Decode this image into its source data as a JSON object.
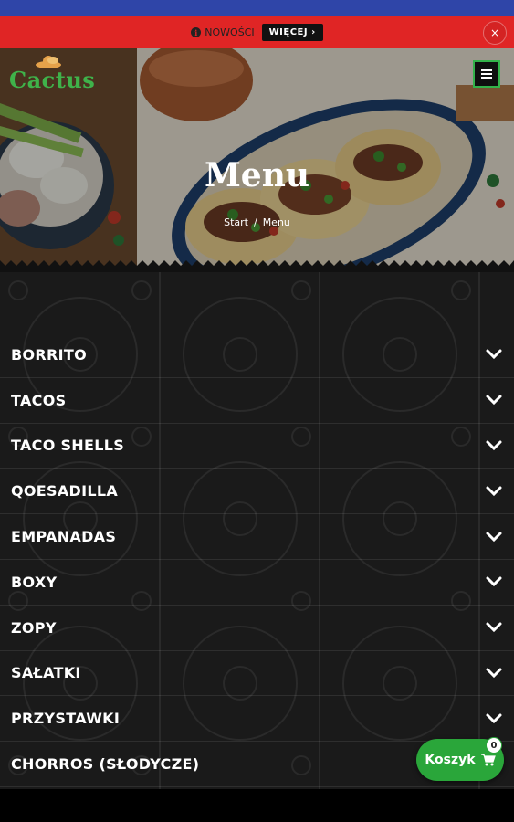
{
  "promo": {
    "text": "NOWOŚCI",
    "more_label": "WIĘCEJ ›",
    "close_label": "×",
    "colors": {
      "bar": "#e02525",
      "button": "#111111"
    }
  },
  "header": {
    "logo_text": "Cactus",
    "menu_icon": "hamburger-icon",
    "page_title": "Menu",
    "breadcrumb": {
      "home": "Start",
      "separator": "/",
      "current": "Menu"
    }
  },
  "menu": {
    "items": [
      {
        "label": "BORRITO"
      },
      {
        "label": "TACOS"
      },
      {
        "label": "TACO SHELLS"
      },
      {
        "label": "QOESADILLA"
      },
      {
        "label": "EMPANADAS"
      },
      {
        "label": "BOXY"
      },
      {
        "label": "ZOPY"
      },
      {
        "label": "SAŁATKI"
      },
      {
        "label": "PRZYSTAWKI"
      },
      {
        "label": "CHORROS (SŁODYCZE)"
      }
    ],
    "expand_icon": "chevron-down-icon"
  },
  "cart": {
    "label": "Koszyk",
    "icon": "cart-icon",
    "count": "0",
    "color": "#2aa63a"
  }
}
